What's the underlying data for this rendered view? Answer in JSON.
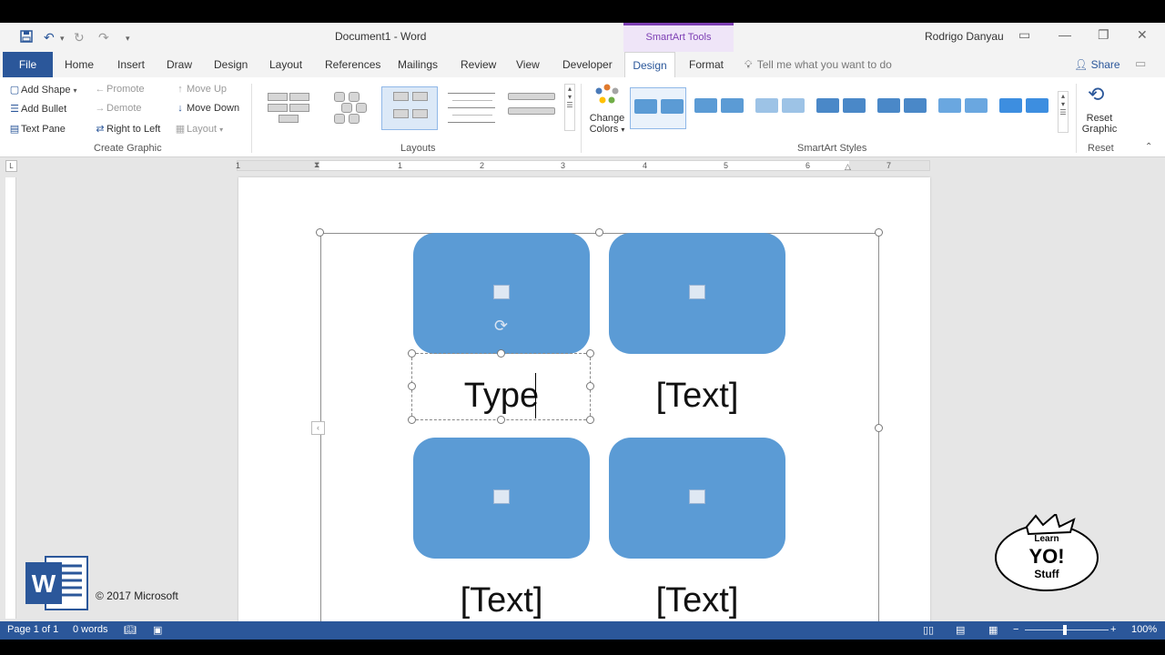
{
  "window": {
    "doc_title": "Document1 - Word",
    "contextual_group": "SmartArt Tools",
    "user": "Rodrigo Danyau"
  },
  "tabs": [
    "File",
    "Home",
    "Insert",
    "Draw",
    "Design",
    "Layout",
    "References",
    "Mailings",
    "Review",
    "View",
    "Developer",
    "Design",
    "Format"
  ],
  "tell_me": "Tell me what you want to do",
  "share": "Share",
  "ribbon": {
    "create_graphic": {
      "add_shape": "Add Shape",
      "add_bullet": "Add Bullet",
      "text_pane": "Text Pane",
      "promote": "Promote",
      "demote": "Demote",
      "right_to_left": "Right to Left",
      "move_up": "Move Up",
      "move_down": "Move Down",
      "layout": "Layout",
      "label": "Create Graphic"
    },
    "layouts_label": "Layouts",
    "change_colors_1": "Change",
    "change_colors_2": "Colors",
    "smartart_styles_label": "SmartArt Styles",
    "reset_graphic_1": "Reset",
    "reset_graphic_2": "Graphic",
    "reset_label": "Reset"
  },
  "ruler": [
    "1",
    "1",
    "2",
    "3",
    "4",
    "5",
    "6",
    "7"
  ],
  "smartart": {
    "typing": "Type",
    "placeholder": "[Text]",
    "placeholder2": "[Text]",
    "placeholder3": "[Text]"
  },
  "branding": {
    "copyright": "© 2017 Microsoft",
    "learn_top": "Learn",
    "learn_mid": "YO!",
    "learn_bottom": "Stuff"
  },
  "status": {
    "page": "Page 1 of 1",
    "words": "0 words",
    "zoom": "100%"
  },
  "colors": {
    "word_blue": "#2b579a",
    "smartart_purple": "#7d3fb4",
    "shape_blue": "#5b9bd5"
  }
}
